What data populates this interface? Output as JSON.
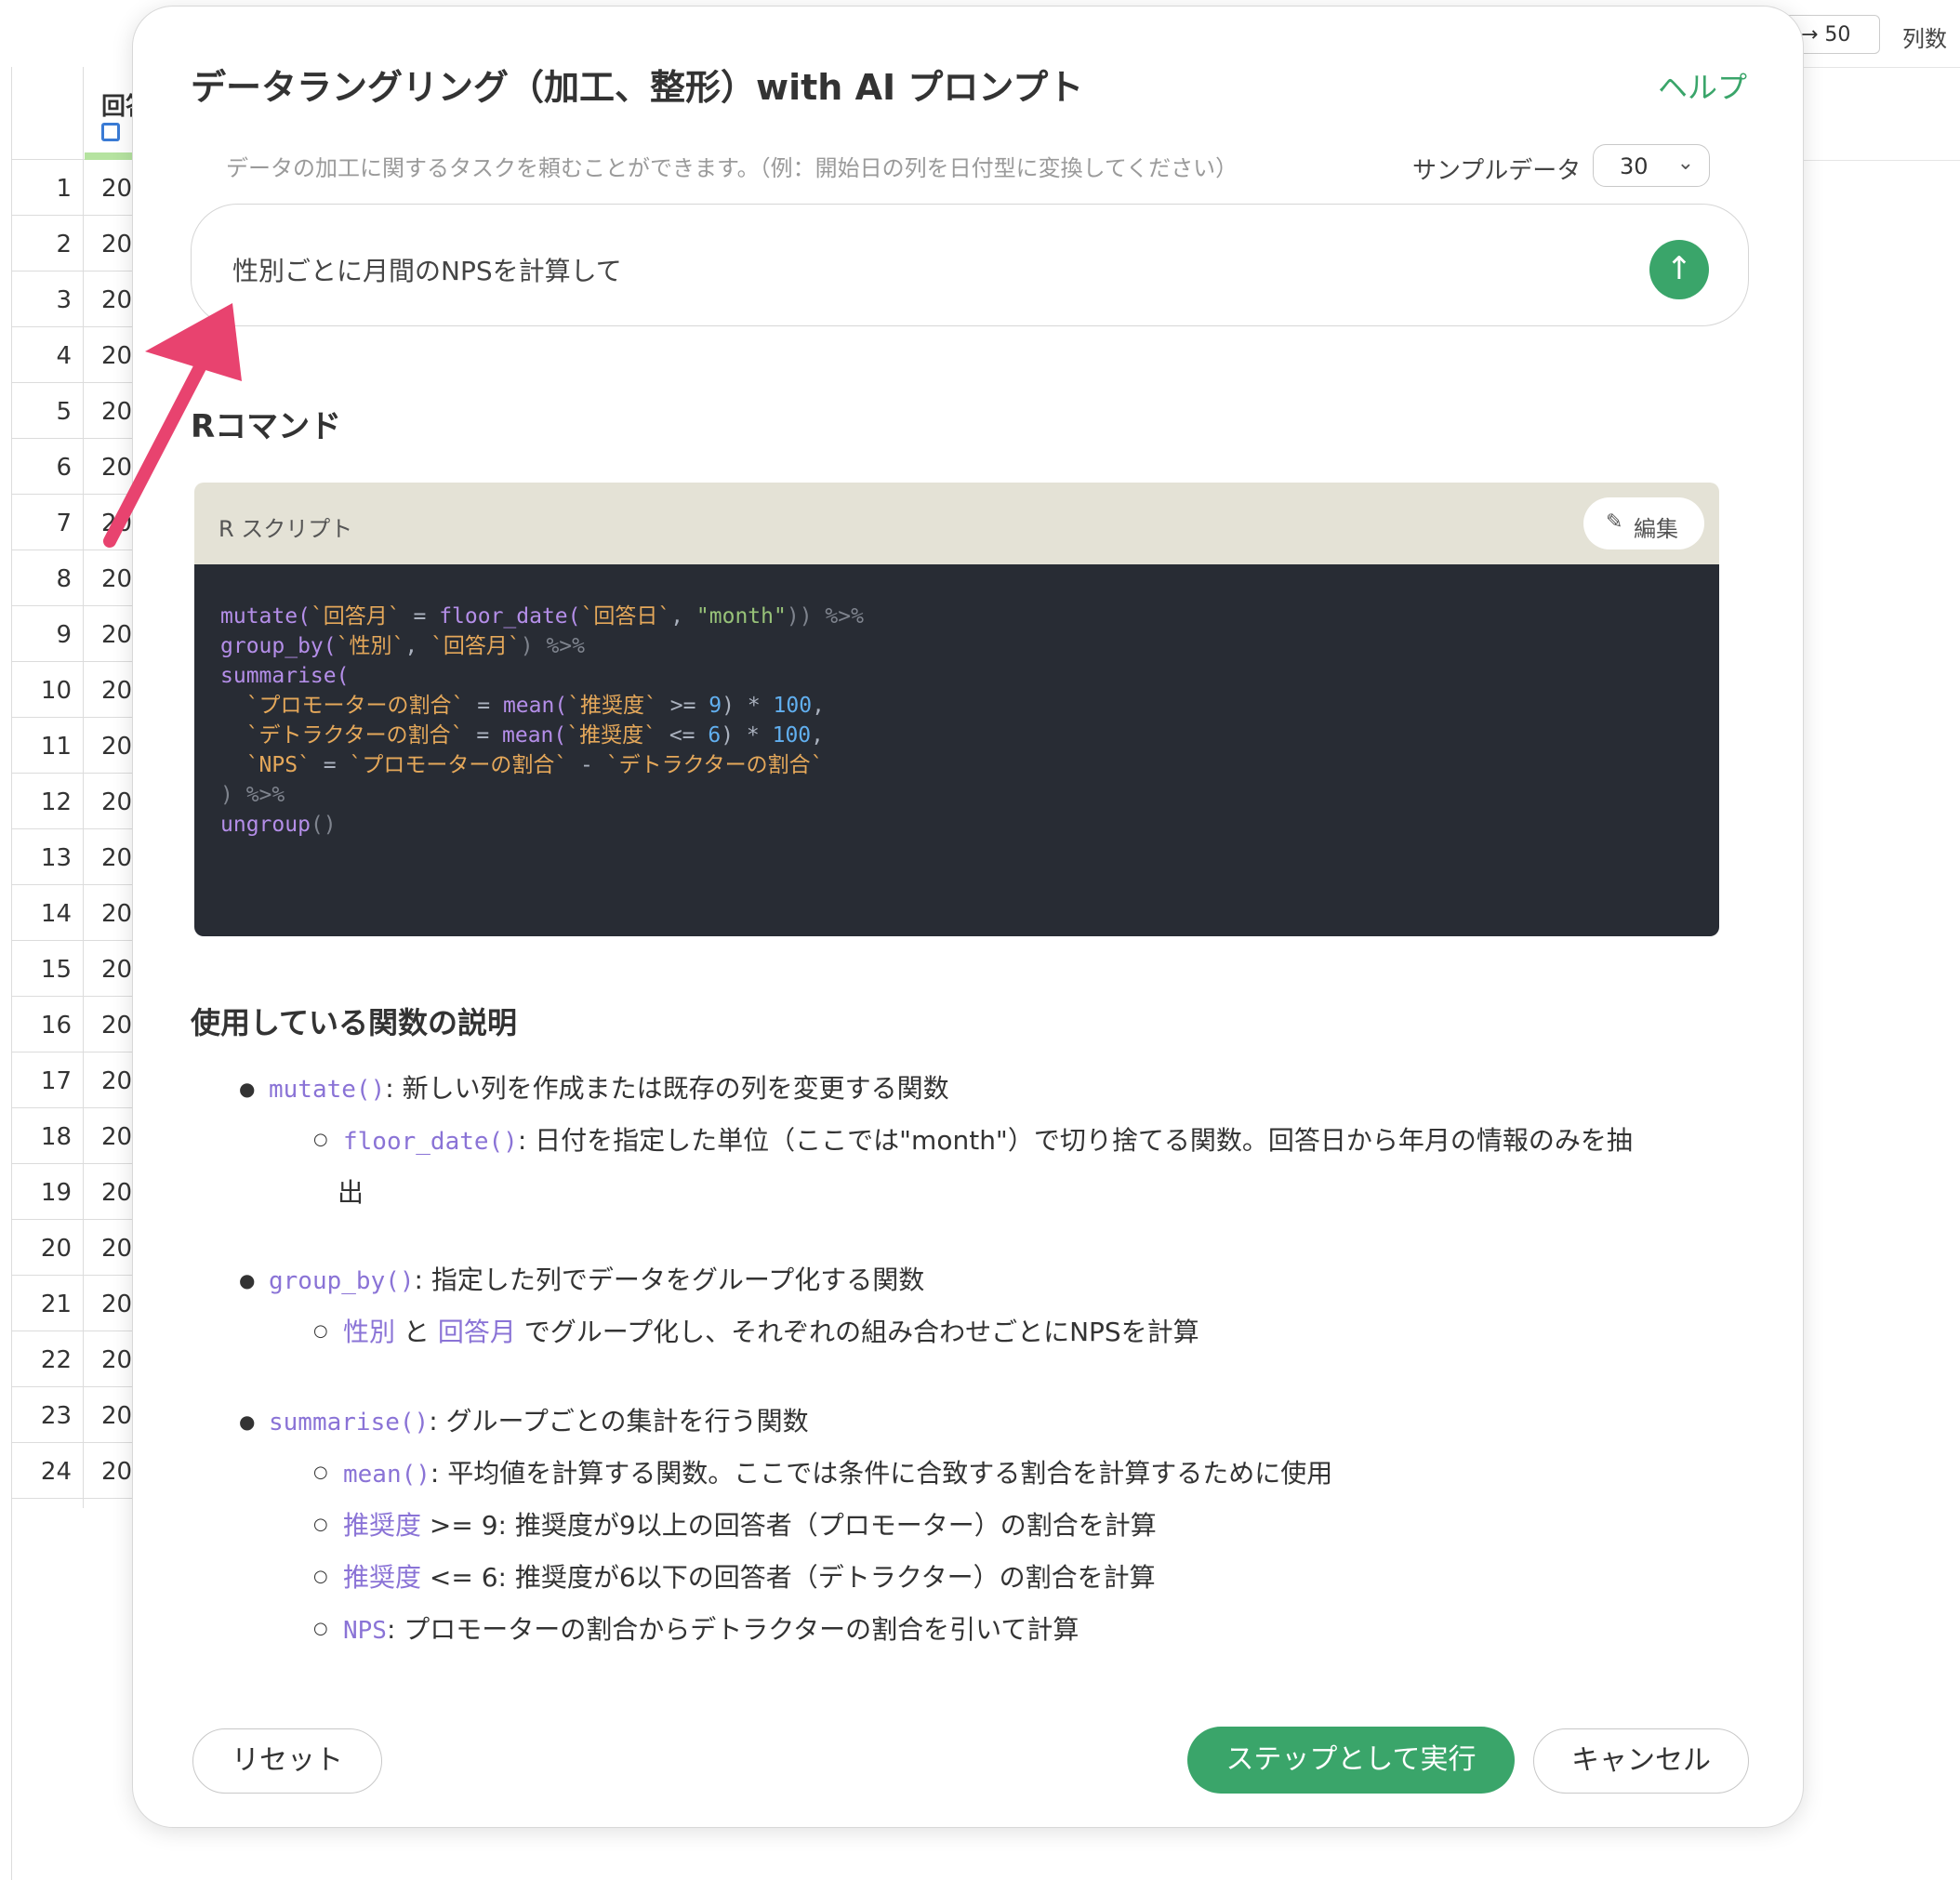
{
  "background": {
    "column_header": "回答",
    "row_numbers": [
      "1",
      "2",
      "3",
      "4",
      "5",
      "6",
      "7",
      "8",
      "9",
      "10",
      "11",
      "12",
      "13",
      "14",
      "15",
      "16",
      "17",
      "18",
      "19",
      "20",
      "21",
      "22",
      "23",
      "24"
    ],
    "cell_prefix": "20",
    "top_right_value": "→ 50",
    "top_right_label": "列数"
  },
  "modal": {
    "title": "データラングリング（加工、整形）with AI プロンプト",
    "help": "ヘルプ",
    "hint": "データの加工に関するタスクを頼むことができます。（例：開始日の列を日付型に変換してください）",
    "sample_label": "サンプルデータ",
    "sample_value": "30",
    "prompt_text": "性別ごとに月間のNPSを計算して",
    "send_icon": "arrow-up-icon",
    "r_command_title": "Rコマンド",
    "code_header": "R スクリプト",
    "edit_label": "編集",
    "description_title": "使用している関数の説明",
    "reset_label": "リセット",
    "run_label": "ステップとして実行",
    "cancel_label": "キャンセル"
  },
  "code": {
    "l1a": "mutate(",
    "l1b": "`回答月`",
    "l1c": " = ",
    "l1d": "floor_date(",
    "l1e": "`回答日`",
    "l1f": ", ",
    "l1g": "\"month\"",
    "l1h": ")) ",
    "l1i": "%>%",
    "l2a": "group_by(",
    "l2b": "`性別`",
    "l2c": ", ",
    "l2d": "`回答月`",
    "l2e": ") ",
    "l2f": "%>%",
    "l3a": "summarise(",
    "l4a": "  `プロモーターの割合`",
    "l4b": " = ",
    "l4c": "mean(",
    "l4d": "`推奨度`",
    "l4e": " >= ",
    "l4f": "9",
    "l4g": ") * ",
    "l4h": "100",
    "l4i": ",",
    "l5a": "  `デトラクターの割合`",
    "l5b": " = ",
    "l5c": "mean(",
    "l5d": "`推奨度`",
    "l5e": " <= ",
    "l5f": "6",
    "l5g": ") * ",
    "l5h": "100",
    "l5i": ",",
    "l6a": "  `NPS`",
    "l6b": " = ",
    "l6c": "`プロモーターの割合`",
    "l6d": " - ",
    "l6e": "`デトラクターの割合`",
    "l7a": ") %>%",
    "l8a": "ungroup",
    "l8b": "()"
  },
  "descriptions": {
    "mutate_fn": "mutate()",
    "mutate_text": ": 新しい列を作成または既存の列を変更する関数",
    "floor_fn": "floor_date()",
    "floor_text": ": 日付を指定した単位（ここでは\"month\"）で切り捨てる関数。回答日から年月の情報のみを抽",
    "floor_text2": "出",
    "groupby_fn": "group_by()",
    "groupby_text": ": 指定した列でデータをグループ化する関数",
    "groupby_sub1": "性別",
    "groupby_sub_and": " と ",
    "groupby_sub2": "回答月",
    "groupby_sub_text": " でグループ化し、それぞれの組み合わせごとにNPSを計算",
    "summarise_fn": "summarise()",
    "summarise_text": ": グループごとの集計を行う関数",
    "mean_fn": "mean()",
    "mean_text": ": 平均値を計算する関数。ここでは条件に合致する割合を計算するために使用",
    "rec1_kw": "推奨度",
    "rec1_text": " >= 9: 推奨度が9以上の回答者（プロモーター）の割合を計算",
    "rec2_kw": "推奨度",
    "rec2_text": " <= 6: 推奨度が6以下の回答者（デトラクター）の割合を計算",
    "nps_kw": "NPS",
    "nps_text": ": プロモーターの割合からデトラクターの割合を引いて計算"
  },
  "colors": {
    "accent": "#3aa56a",
    "arrow": "#e8436f",
    "code_bg": "#282c34"
  }
}
